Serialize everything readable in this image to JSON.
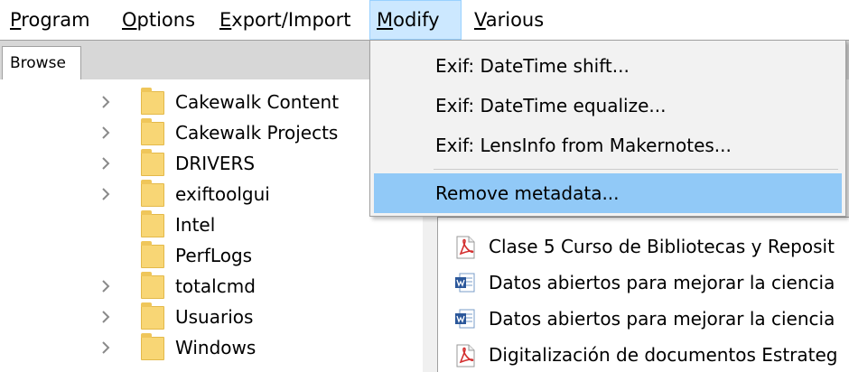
{
  "menubar": {
    "items": [
      {
        "accel": "P",
        "rest": "rogram"
      },
      {
        "accel": "O",
        "rest": "ptions"
      },
      {
        "accel": "E",
        "rest": "xport/Import"
      },
      {
        "accel": "M",
        "rest": "odify"
      },
      {
        "accel": "V",
        "rest": "arious"
      }
    ]
  },
  "tabs": {
    "browse": "Browse"
  },
  "tree": {
    "items": [
      {
        "label": "Cakewalk Content",
        "expandable": true
      },
      {
        "label": "Cakewalk Projects",
        "expandable": true
      },
      {
        "label": "DRIVERS",
        "expandable": true
      },
      {
        "label": "exiftoolgui",
        "expandable": true
      },
      {
        "label": "Intel",
        "expandable": false
      },
      {
        "label": "PerfLogs",
        "expandable": false
      },
      {
        "label": "totalcmd",
        "expandable": true
      },
      {
        "label": "Usuarios",
        "expandable": true
      },
      {
        "label": "Windows",
        "expandable": true
      }
    ]
  },
  "modify_menu": {
    "items": [
      {
        "label": "Exif: DateTime shift..."
      },
      {
        "label": "Exif: DateTime equalize..."
      },
      {
        "label": "Exif: LensInfo from Makernotes..."
      },
      {
        "label": "Remove metadata..."
      }
    ]
  },
  "files": {
    "items": [
      {
        "label": "Clase 5 Curso de Bibliotecas y Reposit",
        "type": "pdf-icon"
      },
      {
        "label": "Datos abiertos para mejorar la ciencia",
        "type": "word-icon"
      },
      {
        "label": "Datos abiertos para mejorar la ciencia",
        "type": "word-icon"
      },
      {
        "label": "Digitalización de documentos Estrateg",
        "type": "pdf-icon"
      }
    ]
  },
  "colors": {
    "menu_active_bg": "#cce8ff",
    "dropdown_hover_bg": "#91c9f7",
    "folder": "#f8d675",
    "pdf_red": "#d32f2f",
    "word_blue": "#2b579a"
  }
}
